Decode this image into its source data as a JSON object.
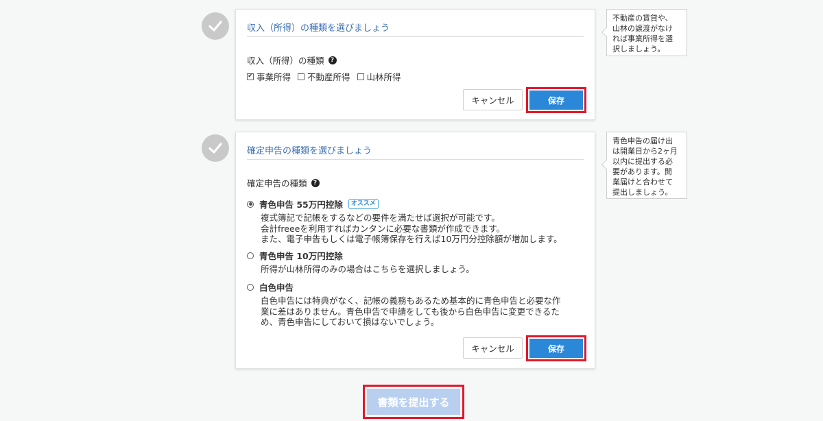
{
  "income_section": {
    "title": "収入（所得）の種類を選びましょう",
    "field_label": "収入（所得）の種類",
    "help_glyph": "?",
    "options": [
      {
        "label": "事業所得",
        "checked": true
      },
      {
        "label": "不動産所得",
        "checked": false
      },
      {
        "label": "山林所得",
        "checked": false
      }
    ],
    "cancel_label": "キャンセル",
    "save_label": "保存",
    "tooltip": [
      "不動産の賃貸や、",
      "山林の譲渡がなけ",
      "れば事業所得を選",
      "択しましょう。"
    ]
  },
  "filing_section": {
    "title": "確定申告の種類を選びましょう",
    "field_label": "確定申告の種類",
    "help_glyph": "?",
    "options": [
      {
        "label": "青色申告 55万円控除",
        "badge": "オススメ",
        "selected": true,
        "desc": [
          "複式簿記で記帳をするなどの要件を満たせば選択が可能です。",
          "会計freeeを利用すればカンタンに必要な書類が作成できます。",
          "また、電子申告もしくは電子帳簿保存を行えば10万円分控除額が増加します。"
        ]
      },
      {
        "label": "青色申告 10万円控除",
        "selected": false,
        "desc": [
          "所得が山林所得のみの場合はこちらを選択しましょう。"
        ]
      },
      {
        "label": "白色申告",
        "selected": false,
        "desc": [
          "白色申告には特典がなく、記帳の義務もあるため基本的に青色申告と必要な作",
          "業に差はありません。青色申告で申請をしても後から白色申告に変更できるた",
          "め、青色申告にしておいて損はないでしょう。"
        ]
      }
    ],
    "cancel_label": "キャンセル",
    "save_label": "保存",
    "tooltip": [
      "青色申告の届け出",
      "は開業日から2ヶ月",
      "以内に提出する必",
      "要があります。開",
      "業届けと合わせて",
      "提出しましょう。"
    ]
  },
  "submit_label": "書類を提出する",
  "colors": {
    "accent": "#2b87d8",
    "highlight": "#e3182a",
    "title_blue": "#3b6fb2",
    "submit_disabled": "#b9cff0"
  }
}
